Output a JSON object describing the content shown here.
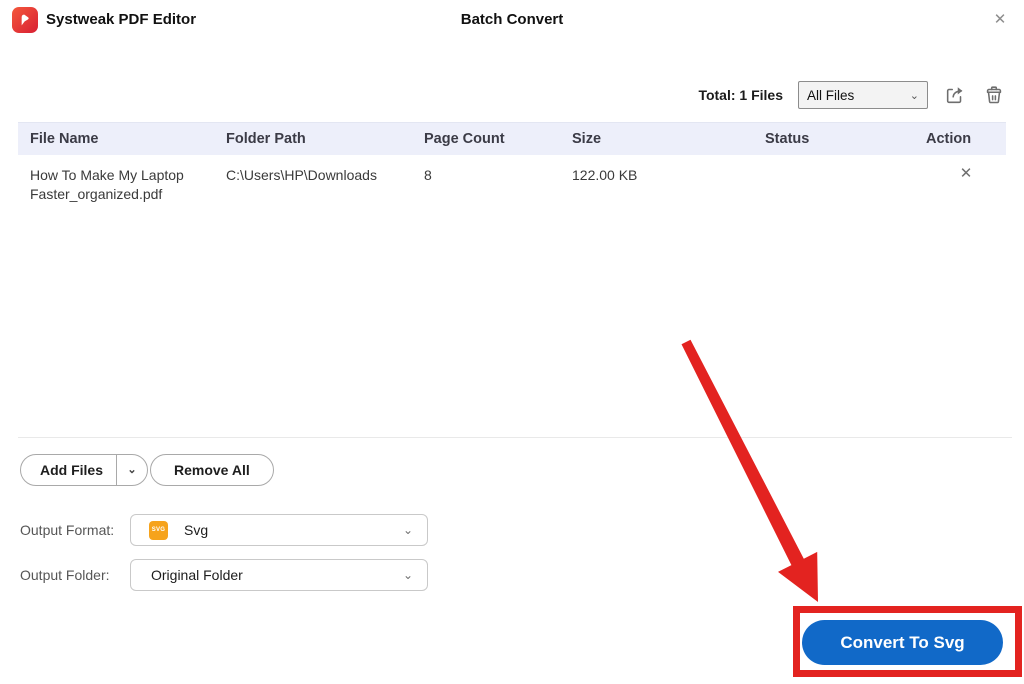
{
  "window": {
    "app_title": "Systweak PDF Editor",
    "page_title": "Batch Convert"
  },
  "toolbar": {
    "total_label": "Total:",
    "total_count": "1",
    "total_suffix": "Files",
    "filter_value": "All Files"
  },
  "table": {
    "columns": [
      "File Name",
      "Folder Path",
      "Page Count",
      "Size",
      "Status",
      "Action"
    ],
    "rows": [
      {
        "file_name": "How To Make My Laptop Faster_organized.pdf",
        "folder_path": "C:\\Users\\HP\\Downloads",
        "page_count": "8",
        "size": "122.00 KB",
        "status": ""
      }
    ]
  },
  "actions": {
    "add_files_label": "Add Files",
    "remove_all_label": "Remove All"
  },
  "output": {
    "format_label": "Output Format:",
    "format_value": "Svg",
    "format_icon_text": "SVG",
    "folder_label": "Output Folder:",
    "folder_value": "Original Folder"
  },
  "convert": {
    "button_label": "Convert To Svg"
  },
  "icons": {
    "close": "✕",
    "chevron_down": "⌄",
    "row_remove": "✕"
  },
  "colors": {
    "accent_blue": "#1169c8",
    "annotation_red": "#e32320",
    "table_header_bg": "#edeffa",
    "format_icon_orange": "#f6a31c"
  }
}
